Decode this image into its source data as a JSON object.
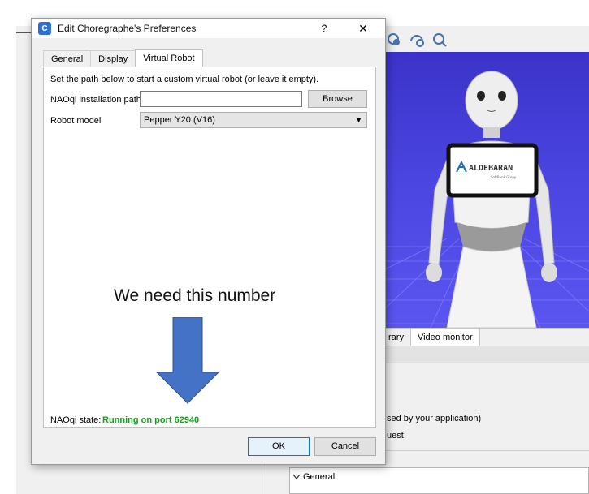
{
  "background_app": {
    "toolbar_icons": [
      "robot-settings-icon",
      "robot-connect-icon",
      "robot-search-icon"
    ],
    "bottom_tabs": [
      {
        "label": "rary",
        "active": false
      },
      {
        "label": "Video monitor",
        "active": true
      }
    ],
    "bottom_text_1": "sed by your application)",
    "bottom_text_2": "uest",
    "properties_section": "General",
    "viewport_brand": "ALDEBARAN",
    "viewport_brand_sub": "SoftBank Group",
    "viewport_color": "#4a44e0"
  },
  "dialog": {
    "title": "Edit Choregraphe's Preferences",
    "help_label": "?",
    "close_label": "✕",
    "tabs": [
      {
        "label": "General",
        "active": false
      },
      {
        "label": "Display",
        "active": false
      },
      {
        "label": "Virtual Robot",
        "active": true
      }
    ],
    "hint": "Set the path below to start a custom virtual robot (or leave it empty).",
    "naoqi_path_label": "NAOqi installation path",
    "naoqi_path_value": "",
    "browse_label": "Browse",
    "robot_model_label": "Robot model",
    "robot_model_value": "Pepper Y20 (V16)",
    "annotation_text": "We need this number",
    "annotation_arrow_color": "#4472c4",
    "naoqi_state_label": "NAOqi state:",
    "naoqi_state_value": "Running on port 62940",
    "state_color": "#15a01c",
    "ok_label": "OK",
    "cancel_label": "Cancel"
  }
}
